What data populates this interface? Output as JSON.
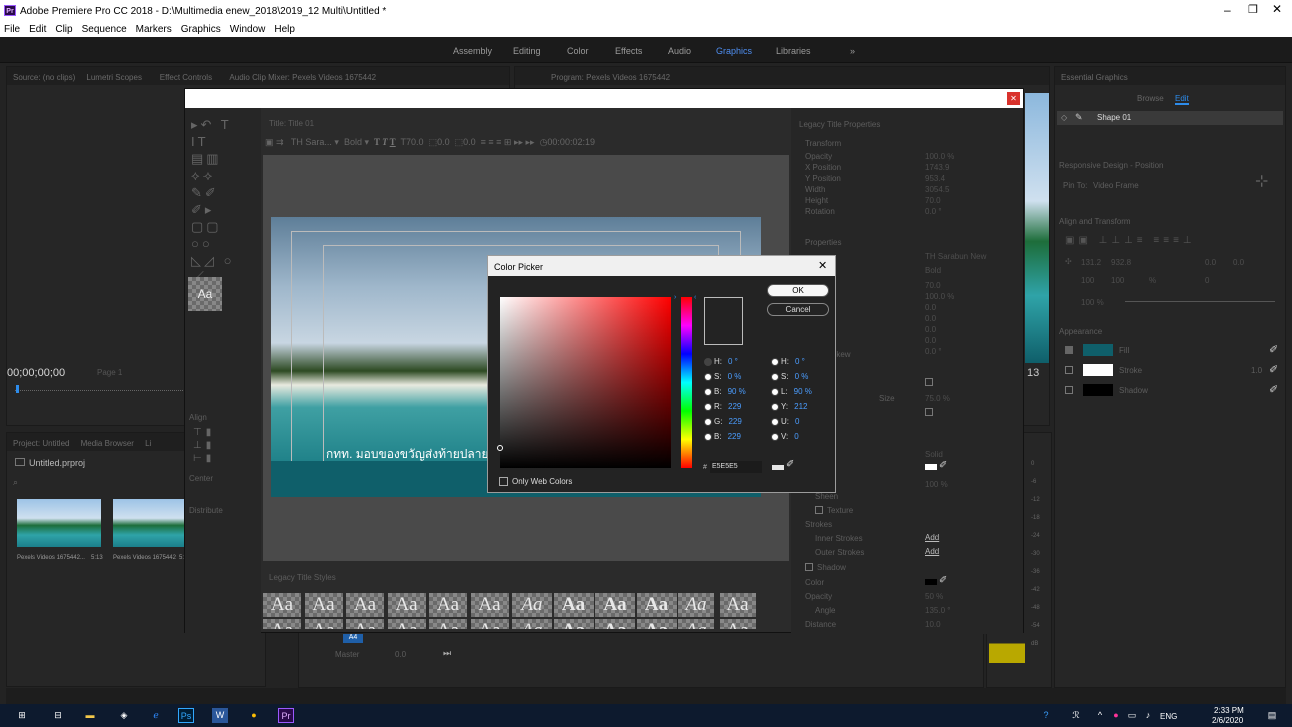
{
  "app": {
    "title": "Adobe Premiere Pro CC 2018 - D:\\Multimedia enew_2018\\2019_12 Multi\\Untitled *",
    "logo": "Pr"
  },
  "menu": [
    "File",
    "Edit",
    "Clip",
    "Sequence",
    "Markers",
    "Graphics",
    "Window",
    "Help"
  ],
  "workspaces": {
    "items": [
      "Assembly",
      "Editing",
      "Color",
      "Effects",
      "Audio",
      "Graphics",
      "Libraries"
    ],
    "active": "Graphics",
    "more": "»"
  },
  "source_panel": {
    "tabs": [
      "Source: (no clips)",
      "Lumetri Scopes",
      "Effect Controls",
      "Audio Clip Mixer: Pexels Videos 1675442"
    ],
    "timecode": "00;00;00;00",
    "page": "Page 1"
  },
  "program_panel": {
    "tab": "Program: Pexels Videos 1675442"
  },
  "project_panel": {
    "tabs": [
      "Project: Untitled",
      "Media Browser",
      "Li"
    ],
    "file": "Untitled.prproj",
    "clips": [
      {
        "name": "Pexels Videos 1675442...",
        "dur": "5:13"
      },
      {
        "name": "Pexels Videos 1675442",
        "dur": "5:1"
      }
    ]
  },
  "essential": {
    "title": "Essential Graphics",
    "tabs": [
      "Browse",
      "Edit"
    ],
    "active_tab": "Edit",
    "layer": "Shape 01",
    "responsive": "Responsive Design - Position",
    "pin_to_label": "Pin To:",
    "pin_to": "Video Frame",
    "align_transform": "Align and Transform",
    "x": "131.2",
    "y": "932.8",
    "w": "100",
    "h": "100",
    "pct": "%",
    "rot": "0.0",
    "rot2": "0.0",
    "ang": "0",
    "opacity": "100 %",
    "appearance": "Appearance",
    "fill": "Fill",
    "stroke": "Stroke",
    "stroke_w": "1.0",
    "shadow": "Shadow"
  },
  "title_dialog": {
    "title_tab": "Title: Title 01",
    "font": "TH Sara...",
    "style": "Bold",
    "size": "70.0",
    "kern": "0.0",
    "lead": "0.0",
    "timecode": "00:00:02:19",
    "thai_text": "กทท. มอบของขวัญส่งท้ายปลายปี",
    "align": "Align",
    "center": "Center",
    "distribute": "Distribute",
    "styles_tab": "Legacy Title Styles",
    "aa": "Aa"
  },
  "properties": {
    "title": "Legacy Title Properties",
    "transform": "Transform",
    "rows": [
      {
        "l": "Opacity",
        "v": "100.0 %"
      },
      {
        "l": "X Position",
        "v": "1743.9"
      },
      {
        "l": "Y Position",
        "v": "953.4"
      },
      {
        "l": "Width",
        "v": "3054.5"
      },
      {
        "l": "Height",
        "v": "70.0"
      },
      {
        "l": "Rotation",
        "v": "0.0 °"
      }
    ],
    "props": "Properties",
    "font_family": "TH Sarabun New",
    "font_style": "Bold",
    "vals": [
      "70.0",
      "100.0 %",
      "0.0",
      "0.0",
      "0.0",
      "0.0",
      "0.0 °"
    ],
    "skew": "Skew",
    "size_label": "Size",
    "size_val": "75.0 %",
    "solid": "Solid",
    "pct100": "100 %",
    "sheen": "Sheen",
    "texture": "Texture",
    "strokes": "Strokes",
    "inner": "Inner Strokes",
    "outer": "Outer Strokes",
    "add": "Add",
    "shadow": "Shadow",
    "color": "Color",
    "opacity": "Opacity",
    "opacity_v": "50 %",
    "angle": "Angle",
    "angle_v": "135.0 °",
    "distance": "Distance",
    "distance_v": "10.0"
  },
  "color_picker": {
    "title": "Color Picker",
    "ok": "OK",
    "cancel": "Cancel",
    "only_web": "Only Web Colors",
    "hex_label": "#",
    "hex": "E5E5E5",
    "hsb": [
      {
        "l": "H:",
        "v": "0 °"
      },
      {
        "l": "S:",
        "v": "0 %"
      },
      {
        "l": "B:",
        "v": "90 %"
      }
    ],
    "hsl": [
      {
        "l": "H:",
        "v": "0 °"
      },
      {
        "l": "S:",
        "v": "0 %"
      },
      {
        "l": "L:",
        "v": "90 %"
      }
    ],
    "rgb": [
      {
        "l": "R:",
        "v": "229"
      },
      {
        "l": "G:",
        "v": "229"
      },
      {
        "l": "B:",
        "v": "229"
      }
    ],
    "yuv": [
      {
        "l": "Y:",
        "v": "212"
      },
      {
        "l": "U:",
        "v": "0"
      },
      {
        "l": "V:",
        "v": "0"
      }
    ],
    "swatch": "#e5e5e5"
  },
  "timeline": {
    "a4": "A4",
    "master": "Master",
    "master_v": "0.0",
    "frame": "13"
  },
  "meter_ticks": [
    "0",
    "-6",
    "-12",
    "-18",
    "-24",
    "-30",
    "-36",
    "-42",
    "-48",
    "-54",
    "dB"
  ],
  "taskbar": {
    "time": "2:33 PM",
    "date": "2/6/2020",
    "lang": "ENG"
  },
  "colors": {
    "accent": "#2d8ceb",
    "teal": "#0f5f6a",
    "close": "#d9322c"
  }
}
